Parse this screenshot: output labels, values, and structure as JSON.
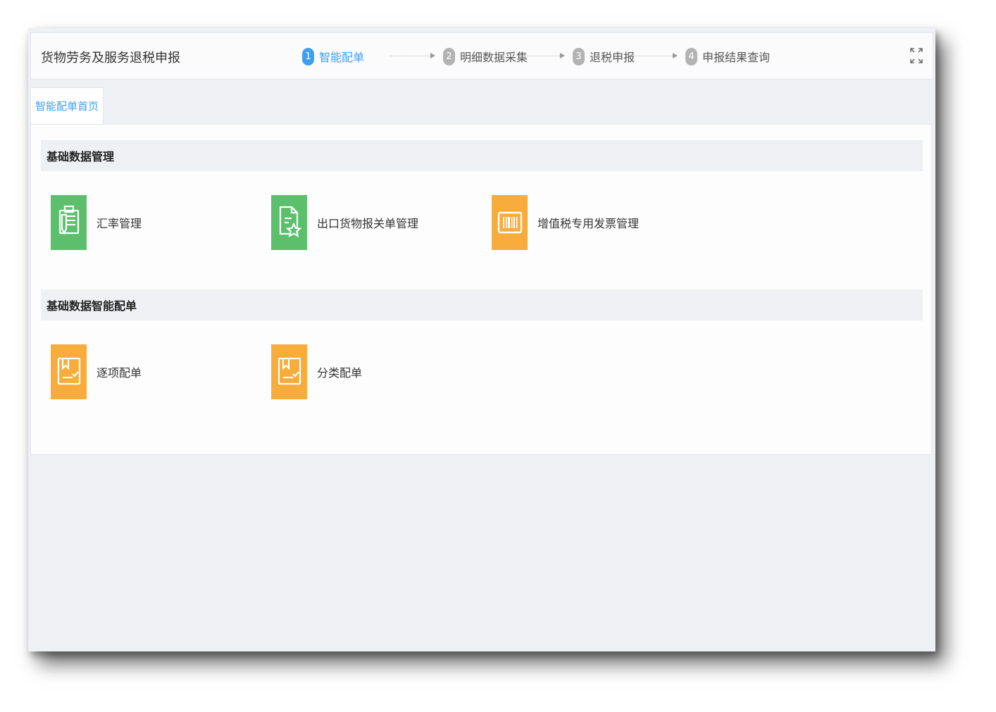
{
  "app": {
    "title": "货物劳务及服务退税申报"
  },
  "steps": [
    {
      "num": "1",
      "label": "智能配单",
      "active": true
    },
    {
      "num": "2",
      "label": "明细数据采集",
      "active": false
    },
    {
      "num": "3",
      "label": "退税申报",
      "active": false
    },
    {
      "num": "4",
      "label": "申报结果查询",
      "active": false
    }
  ],
  "toolbar": {
    "fullscreen_icon": "fullscreen-expand-icon"
  },
  "tabs": [
    {
      "label": "智能配单首页",
      "active": true
    }
  ],
  "sections": [
    {
      "title": "基础数据管理",
      "items": [
        {
          "label": "汇率管理",
          "icon": "document-edit-icon",
          "color": "#5cbf6c"
        },
        {
          "label": "出口货物报关单管理",
          "icon": "document-star-icon",
          "color": "#5cbf6c"
        },
        {
          "label": "增值税专用发票管理",
          "icon": "barcode-invoice-icon",
          "color": "#f7ac3c"
        }
      ]
    },
    {
      "title": "基础数据智能配单",
      "items": [
        {
          "label": "逐项配单",
          "icon": "bookmark-check-icon",
          "color": "#f7ac3c"
        },
        {
          "label": "分类配单",
          "icon": "bookmark-check-icon",
          "color": "#f7ac3c"
        }
      ]
    }
  ],
  "colors": {
    "accent": "#3f9ff1",
    "green": "#5cbf6c",
    "orange": "#f7ac3c",
    "inactive_step": "#b3b3b3"
  }
}
